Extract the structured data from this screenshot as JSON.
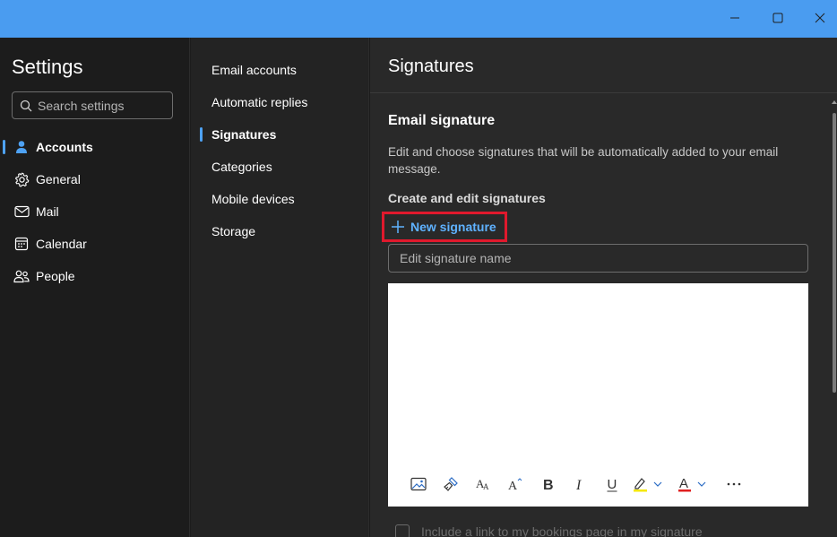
{
  "window": {
    "controls": [
      "minimize-icon",
      "maximize-icon",
      "close-icon"
    ]
  },
  "sidebar": {
    "title": "Settings",
    "search_placeholder": "Search settings",
    "items": [
      {
        "label": "Accounts",
        "icon": "person-icon",
        "active": true
      },
      {
        "label": "General",
        "icon": "gear-icon",
        "active": false
      },
      {
        "label": "Mail",
        "icon": "mail-icon",
        "active": false
      },
      {
        "label": "Calendar",
        "icon": "calendar-icon",
        "active": false
      },
      {
        "label": "People",
        "icon": "people-icon",
        "active": false
      }
    ]
  },
  "subnav": {
    "items": [
      {
        "label": "Email accounts",
        "active": false
      },
      {
        "label": "Automatic replies",
        "active": false
      },
      {
        "label": "Signatures",
        "active": true
      },
      {
        "label": "Categories",
        "active": false
      },
      {
        "label": "Mobile devices",
        "active": false
      },
      {
        "label": "Storage",
        "active": false
      }
    ]
  },
  "content": {
    "page_title": "Signatures",
    "section_title": "Email signature",
    "description": "Edit and choose signatures that will be automatically added to your email message.",
    "subsection_title": "Create and edit signatures",
    "new_signature_label": "New signature",
    "signature_name_placeholder": "Edit signature name",
    "toolbar": [
      "insert-picture-icon",
      "format-painter-icon",
      "font-size-icon",
      "grow-font-icon",
      "bold-icon",
      "italic-icon",
      "underline-icon",
      "highlight-icon",
      "font-color-icon",
      "more-options-icon"
    ],
    "bookings_checkbox_label": "Include a link to my bookings page in my signature",
    "bookings_checkbox_checked": false
  },
  "colors": {
    "titlebar": "#4a9cf0",
    "accent": "#4ea2f4",
    "link": "#5fb2ff",
    "highlight_box": "#e0192d",
    "background": "#1c1c1c"
  }
}
